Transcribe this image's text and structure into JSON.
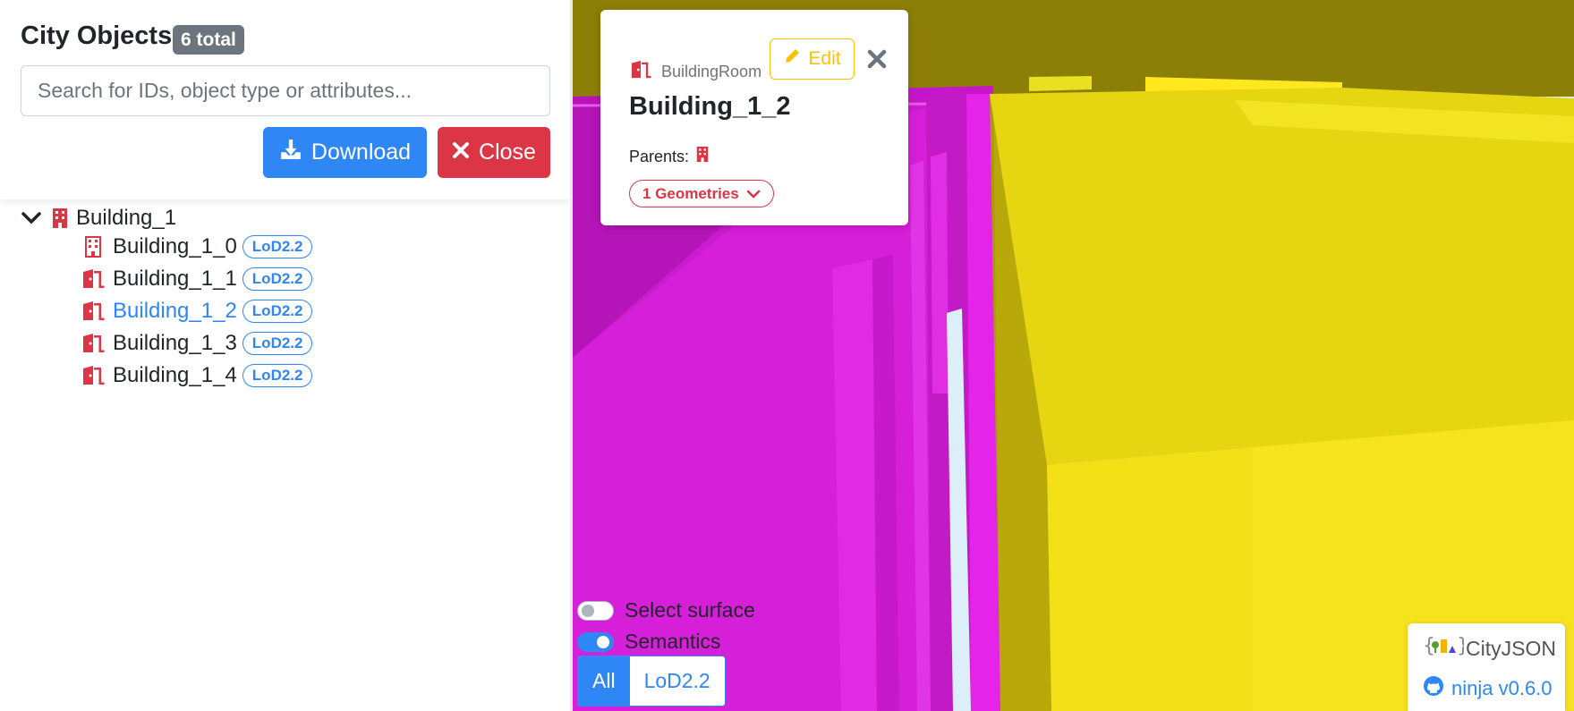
{
  "sidebar": {
    "title": "City Objects",
    "total_badge": "6 total",
    "search_placeholder": "Search for IDs, object type or attributes...",
    "download_label": "Download",
    "close_label": "Close"
  },
  "tree": {
    "root": {
      "label": "Building_1",
      "icon": "building-icon",
      "expanded": true
    },
    "children": [
      {
        "label": "Building_1_0",
        "lod": "LoD2.2",
        "icon": "building-icon",
        "active": false
      },
      {
        "label": "Building_1_1",
        "lod": "LoD2.2",
        "icon": "door-icon",
        "active": false
      },
      {
        "label": "Building_1_2",
        "lod": "LoD2.2",
        "icon": "door-icon",
        "active": true
      },
      {
        "label": "Building_1_3",
        "lod": "LoD2.2",
        "icon": "door-icon",
        "active": false
      },
      {
        "label": "Building_1_4",
        "lod": "LoD2.2",
        "icon": "door-icon",
        "active": false
      }
    ]
  },
  "info_card": {
    "object_type": "BuildingRoom",
    "object_id": "Building_1_2",
    "edit_label": "Edit",
    "parents_label": "Parents:",
    "geometries_label": "1 Geometries"
  },
  "viewer": {
    "select_surface_label": "Select surface",
    "select_surface_on": false,
    "semantics_label": "Semantics",
    "semantics_on": true,
    "lod_options": [
      "All",
      "LoD2.2"
    ],
    "lod_selected": "All"
  },
  "brand": {
    "name": "CityJSON",
    "app_link": "ninja v0.6.0"
  },
  "colors": {
    "primary": "#2f86f5",
    "danger": "#dc3545",
    "warning": "#ffc107",
    "secondary": "#6c757d",
    "room_magenta": "#d21bd8",
    "roof_yellow": "#f0df1c",
    "wall_olive": "#8c7f07"
  }
}
